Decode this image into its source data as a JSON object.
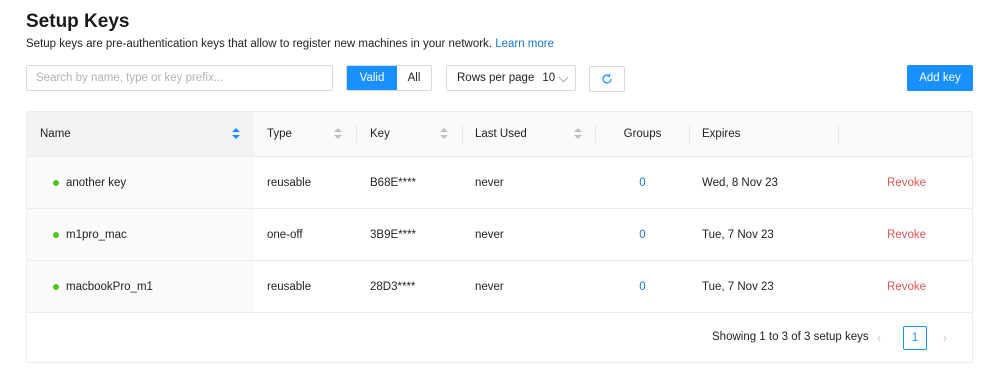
{
  "header": {
    "title": "Setup Keys",
    "description": "Setup keys are pre-authentication keys that allow to register new machines in your network.",
    "learn_more": "Learn more"
  },
  "toolbar": {
    "search_placeholder": "Search by name, type or key prefix...",
    "filter_valid": "Valid",
    "filter_all": "All",
    "filter_selected": "Valid",
    "rows_per_page_label": "Rows per page",
    "rows_per_page_value": "10",
    "refresh_icon": "refresh-icon",
    "add_key_label": "Add key"
  },
  "table": {
    "columns": [
      "Name",
      "Type",
      "Key",
      "Last Used",
      "Groups",
      "Expires"
    ],
    "sorted_column": "Name",
    "rows": [
      {
        "name": "another key",
        "type": "reusable",
        "key": "B68E****",
        "last_used": "never",
        "groups": "0",
        "expires": "Wed, 8 Nov 23",
        "action": "Revoke",
        "status": "valid"
      },
      {
        "name": "m1pro_mac",
        "type": "one-off",
        "key": "3B9E****",
        "last_used": "never",
        "groups": "0",
        "expires": "Tue, 7 Nov 23",
        "action": "Revoke",
        "status": "valid"
      },
      {
        "name": "macbookPro_m1",
        "type": "reusable",
        "key": "28D3****",
        "last_used": "never",
        "groups": "0",
        "expires": "Tue, 7 Nov 23",
        "action": "Revoke",
        "status": "valid"
      }
    ]
  },
  "pagination": {
    "summary": "Showing 1 to 3 of 3 setup keys",
    "current_page": "1",
    "prev_icon": "chevron-left-icon",
    "next_icon": "chevron-right-icon"
  },
  "colors": {
    "primary": "#1890ff",
    "link": "#1677d2",
    "revoke": "#e05555",
    "status_dot": "#52c41a"
  }
}
